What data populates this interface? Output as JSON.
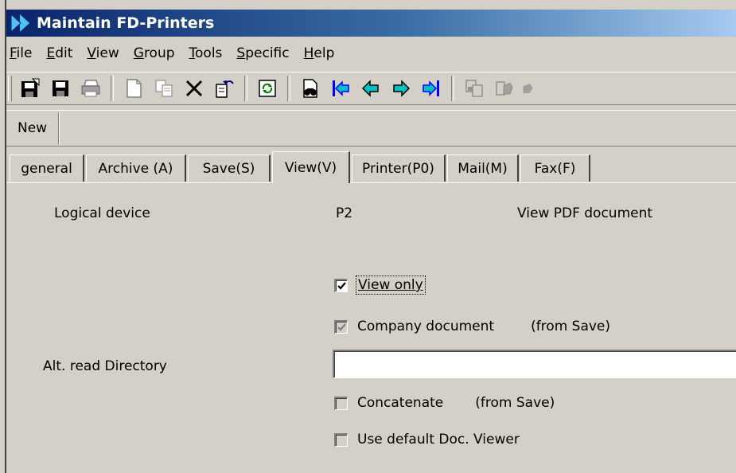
{
  "window": {
    "title": "Maintain FD-Printers"
  },
  "menu": [
    {
      "mnemonic": "F",
      "rest": "ile"
    },
    {
      "mnemonic": "E",
      "rest": "dit"
    },
    {
      "mnemonic": "V",
      "rest": "iew"
    },
    {
      "mnemonic": "G",
      "rest": "roup"
    },
    {
      "mnemonic": "T",
      "rest": "ools"
    },
    {
      "mnemonic": "S",
      "rest": "pecific"
    },
    {
      "mnemonic": "H",
      "rest": "elp"
    }
  ],
  "toolbar": {
    "icons": [
      "new-record-icon",
      "save-icon",
      "print-icon",
      "blank-document-icon",
      "copy-icon",
      "delete-icon",
      "undo-document-icon",
      "refresh-icon",
      "search-binoculars-icon",
      "first-record-icon",
      "previous-record-icon",
      "next-record-icon",
      "last-record-icon",
      "copy-disabled-icon",
      "hand-disabled-icon"
    ]
  },
  "actionbar": {
    "new_label": "New"
  },
  "tabs": [
    {
      "label": "general",
      "active": false
    },
    {
      "label": "Archive (A)",
      "active": false
    },
    {
      "label": "Save(S)",
      "active": false
    },
    {
      "label": "View(V)",
      "active": true
    },
    {
      "label": "Printer(P0)",
      "active": false
    },
    {
      "label": "Mail(M)",
      "active": false
    },
    {
      "label": "Fax(F)",
      "active": false
    }
  ],
  "panel": {
    "logical_device_label": "Logical device",
    "logical_device_value": "P2",
    "view_pdf_label": "View PDF document",
    "view_only": {
      "label": "View only",
      "checked": true
    },
    "company_document": {
      "label": "Company document",
      "checked": true,
      "disabled": true,
      "note": "(from Save)"
    },
    "alt_read_directory_label": "Alt. read Directory",
    "alt_read_directory_value": "",
    "concatenate": {
      "label": "Concatenate",
      "checked": false,
      "disabled": true,
      "note": "(from Save)"
    },
    "use_default_viewer": {
      "label": "Use default Doc. Viewer",
      "checked": false
    }
  },
  "colors": {
    "window_bg": "#d4d0c8",
    "title_start": "#0a246a",
    "title_end": "#a6caf0",
    "nav_arrow": "#00c0c0",
    "nav_arrow_blue": "#0000ff"
  }
}
